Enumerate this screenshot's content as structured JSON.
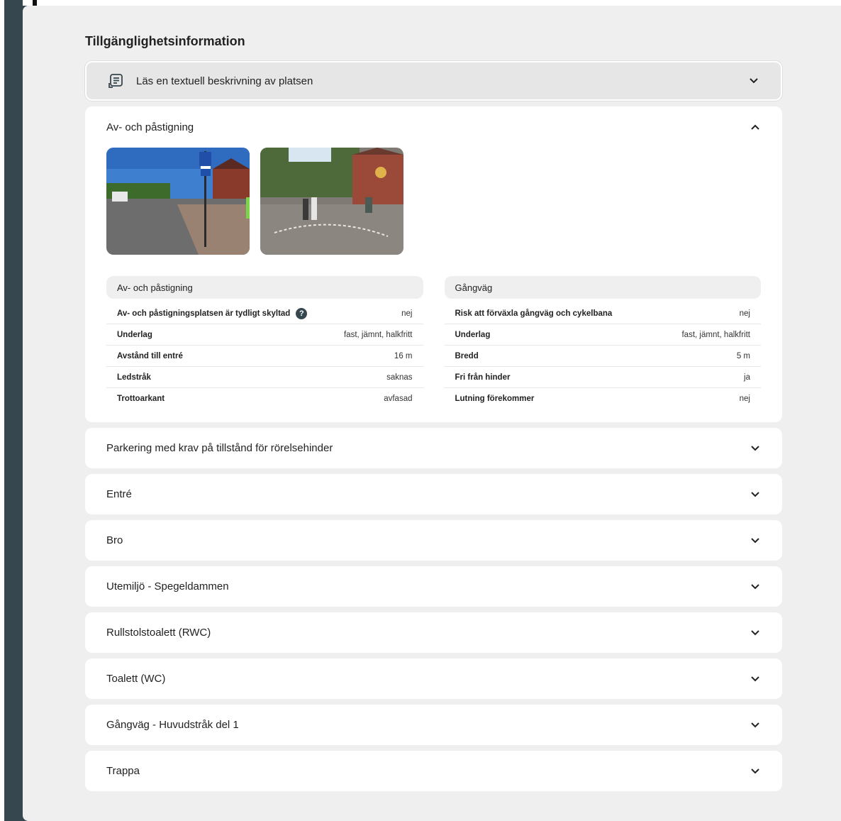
{
  "section_title": "Tillgänglighetsinformation",
  "textual_description": {
    "label": "Läs en textuell beskrivning av platsen",
    "icon": "document-list-icon"
  },
  "expanded_panel": {
    "title": "Av- och påstigning",
    "photos": [
      {
        "name": "parking-sign-street-photo"
      },
      {
        "name": "courtyard-walkway-photo"
      }
    ],
    "tables": [
      {
        "header": "Av- och påstigning",
        "rows": [
          {
            "key": "Av- och påstigningsplatsen är tydligt skyltad",
            "value": "nej",
            "help": "?"
          },
          {
            "key": "Underlag",
            "value": "fast, jämnt, halkfritt"
          },
          {
            "key": "Avstånd till entré",
            "value": "16 m"
          },
          {
            "key": "Ledstråk",
            "value": "saknas"
          },
          {
            "key": "Trottoarkant",
            "value": "avfasad"
          }
        ]
      },
      {
        "header": "Gångväg",
        "rows": [
          {
            "key": "Risk att förväxla gångväg och cykelbana",
            "value": "nej"
          },
          {
            "key": "Underlag",
            "value": "fast, jämnt, halkfritt"
          },
          {
            "key": "Bredd",
            "value": "5 m"
          },
          {
            "key": "Fri från hinder",
            "value": "ja"
          },
          {
            "key": "Lutning förekommer",
            "value": "nej"
          }
        ]
      }
    ]
  },
  "collapsed_panels": [
    {
      "title": "Parkering med krav på tillstånd för rörelsehinder"
    },
    {
      "title": "Entré"
    },
    {
      "title": "Bro"
    },
    {
      "title": "Utemiljö - Spegeldammen"
    },
    {
      "title": "Rullstolstoalett (RWC)"
    },
    {
      "title": "Toalett (WC)"
    },
    {
      "title": "Gångväg - Huvudstråk del 1"
    },
    {
      "title": "Trappa"
    }
  ],
  "colors": {
    "sidebar": "#36474f",
    "background": "#efefef",
    "panel": "#ffffff"
  }
}
